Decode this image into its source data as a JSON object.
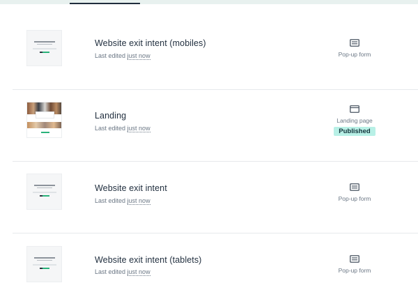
{
  "items": [
    {
      "title": "Website exit intent (mobiles)",
      "subtitle_prefix": "Last edited ",
      "subtitle_time": "just now",
      "type_label": "Pop-up form",
      "type_icon": "popup-form-icon",
      "status": ""
    },
    {
      "title": "Landing",
      "subtitle_prefix": "Last edited ",
      "subtitle_time": "just now",
      "type_label": "Landing page",
      "type_icon": "landing-page-icon",
      "status": "Published"
    },
    {
      "title": "Website exit intent",
      "subtitle_prefix": "Last edited ",
      "subtitle_time": "just now",
      "type_label": "Pop-up form",
      "type_icon": "popup-form-icon",
      "status": ""
    },
    {
      "title": "Website exit intent (tablets)",
      "subtitle_prefix": "Last edited ",
      "subtitle_time": "just now",
      "type_label": "Pop-up form",
      "type_icon": "popup-form-icon",
      "status": ""
    }
  ],
  "colors": {
    "accent_tab": "#1f2d3d",
    "published_badge_bg": "#b8f0e6",
    "preview_button": "#29b27a"
  }
}
